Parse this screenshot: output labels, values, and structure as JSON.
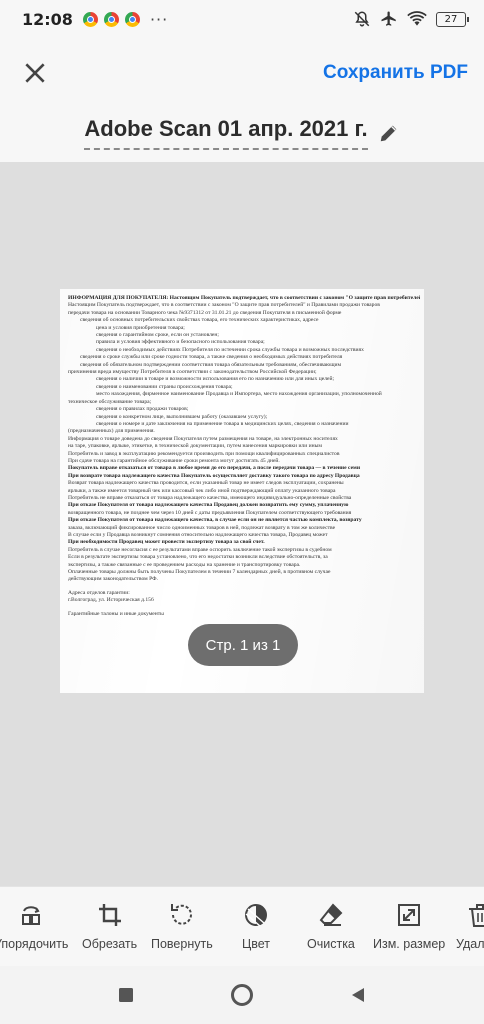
{
  "status_bar": {
    "time": "12:08",
    "app_icons": [
      "chrome-icon",
      "chrome-icon",
      "chrome-icon"
    ],
    "more": "···",
    "battery": "27"
  },
  "header": {
    "close_icon": "close-icon",
    "save_label": "Сохранить PDF",
    "title": "Adobe Scan 01 апр. 2021 г.",
    "edit_icon": "pencil-icon"
  },
  "document": {
    "lines": [
      "ИНФОРМАЦИЯ ДЛЯ ПОКУПАТЕЛЯ: Настоящим Покупатель подтверждает, что в соответствии с законом \"О защите прав потребителей\", и Правилами",
      "Настоящим Покупатель подтверждает, что в соответствии с законом \"О защите прав потребителей\" и Правилами продажи товаров",
      "передачи товара на основании Товарного чека №9371312 от 31.01.21 до сведения Покупателя в письменной форме",
      "сведения об основных потребительских свойствах товара, его технических характеристиках, адресе",
      "цена и условия приобретения товара;",
      "сведения о гарантийном сроке, если он установлен;",
      "правила и условия эффективного и безопасного использования товара;",
      "сведения о необходимых действиях Потребителя по истечении срока службы товара и возможных последствиях",
      "сведения о сроке службы или сроке годности товара, а также сведения о необходимых действиях потребителя",
      "сведения об обязательном подтверждении соответствия товара обязательным требованиям, обеспечивающим",
      "причинения вреда имуществу Потребителя в соответствии с законодательством Российской Федерации;",
      "сведения о наличии в товаре и возможности использования его по назначению или для иных целей;",
      "сведения о наименовании страны происхождения товара;",
      "место нахождения, фирменное наименование Продавца и Импортера, место нахождения организации, уполномоченной",
      "техническое обслуживание товара;",
      "сведения о правилах продажи товаров;",
      "сведения о конкретном лице, выполнившем работу (оказавшем услугу);",
      "сведения о номере и дате заключения на применение товара в медицинских целях, сведения о назначении",
      "(предназначенных) для применения.",
      "Информация о товаре доведена до сведения Покупателя путем размещения на товаре, на электронных носителях",
      "на таре, упаковке, ярлыке, этикетке, в технической документации, путем нанесения маркировки или иным",
      "Потребитель и завод в эксплуатацию рекомендуется производить при помощи квалифицированных специалистов",
      "При сдаче товара на гарантийное обслуживание сроки ремонта могут достигать 45 дней.",
      "Покупатель вправе отказаться от товара в любое время до его передачи, а после передачи товара — в течение семи",
      "При возврате товара надлежащего качества Покупатель осуществляет доставку такого товара по адресу Продавца",
      "Возврат товара надлежащего качества проводится, если указанный товар не имеет следов эксплуатации, сохранены",
      "ярлыки, а также имеется товарный чек или кассовый чек либо иной подтверждающий оплату указанного товара",
      "Потребитель не вправе отказаться от товара надлежащего качества, имеющего индивидуально-определенные свойства",
      "При отказе Покупателя от товара надлежащего качества Продавец должен возвратить ему сумму, уплаченную",
      "возвращенного товара, не позднее чем через 10 дней с даты предъявления Покупателем соответствующего требования",
      "При отказе Покупателя от товара надлежащего качества, в случае если он не является частью комплекта, возврату",
      "заказа, включающий фиксированное число одноименных товаров в ней, подлежат возврату в том же количестве",
      "В случае если у Продавца возникнут сомнения относительно надлежащего качества товара, Продавец может",
      "При необходимости Продавец может провести экспертизу товара за свой счет.",
      "Потребитель в случае несогласия с ее результатами вправе оспорить заключение такой экспертизы в судебном",
      "Если в результате экспертизы товара установлено, что его недостатки возникли вследствие обстоятельств, за",
      "экспертизы, а также связанные с ее проведением расходы на хранение и транспортировку товара.",
      "Оплаченные товары должны быть получены Покупателем в течении 7 календарных дней, в противном случае",
      "действующим законодательством РФ.",
      "Адреса отделов гарантии:",
      "г.Волгоград, ул. Историческая д.156",
      "Гарантийные талоны и иные документы"
    ]
  },
  "pager": {
    "label": "Стр. 1 из 1"
  },
  "toolbar": {
    "tools": [
      {
        "icon": "reorder-icon",
        "label": "Упорядочить"
      },
      {
        "icon": "crop-icon",
        "label": "Обрезать"
      },
      {
        "icon": "rotate-icon",
        "label": "Повернуть"
      },
      {
        "icon": "color-icon",
        "label": "Цвет"
      },
      {
        "icon": "eraser-icon",
        "label": "Очистка"
      },
      {
        "icon": "resize-icon",
        "label": "Изм. размер"
      },
      {
        "icon": "trash-icon",
        "label": "Удалить"
      }
    ]
  },
  "nav": {
    "icons": [
      "recents-icon",
      "home-icon",
      "back-icon"
    ]
  },
  "colors": {
    "accent": "#1473e6",
    "pill": "#6e6e6e",
    "background": "#dedede"
  }
}
